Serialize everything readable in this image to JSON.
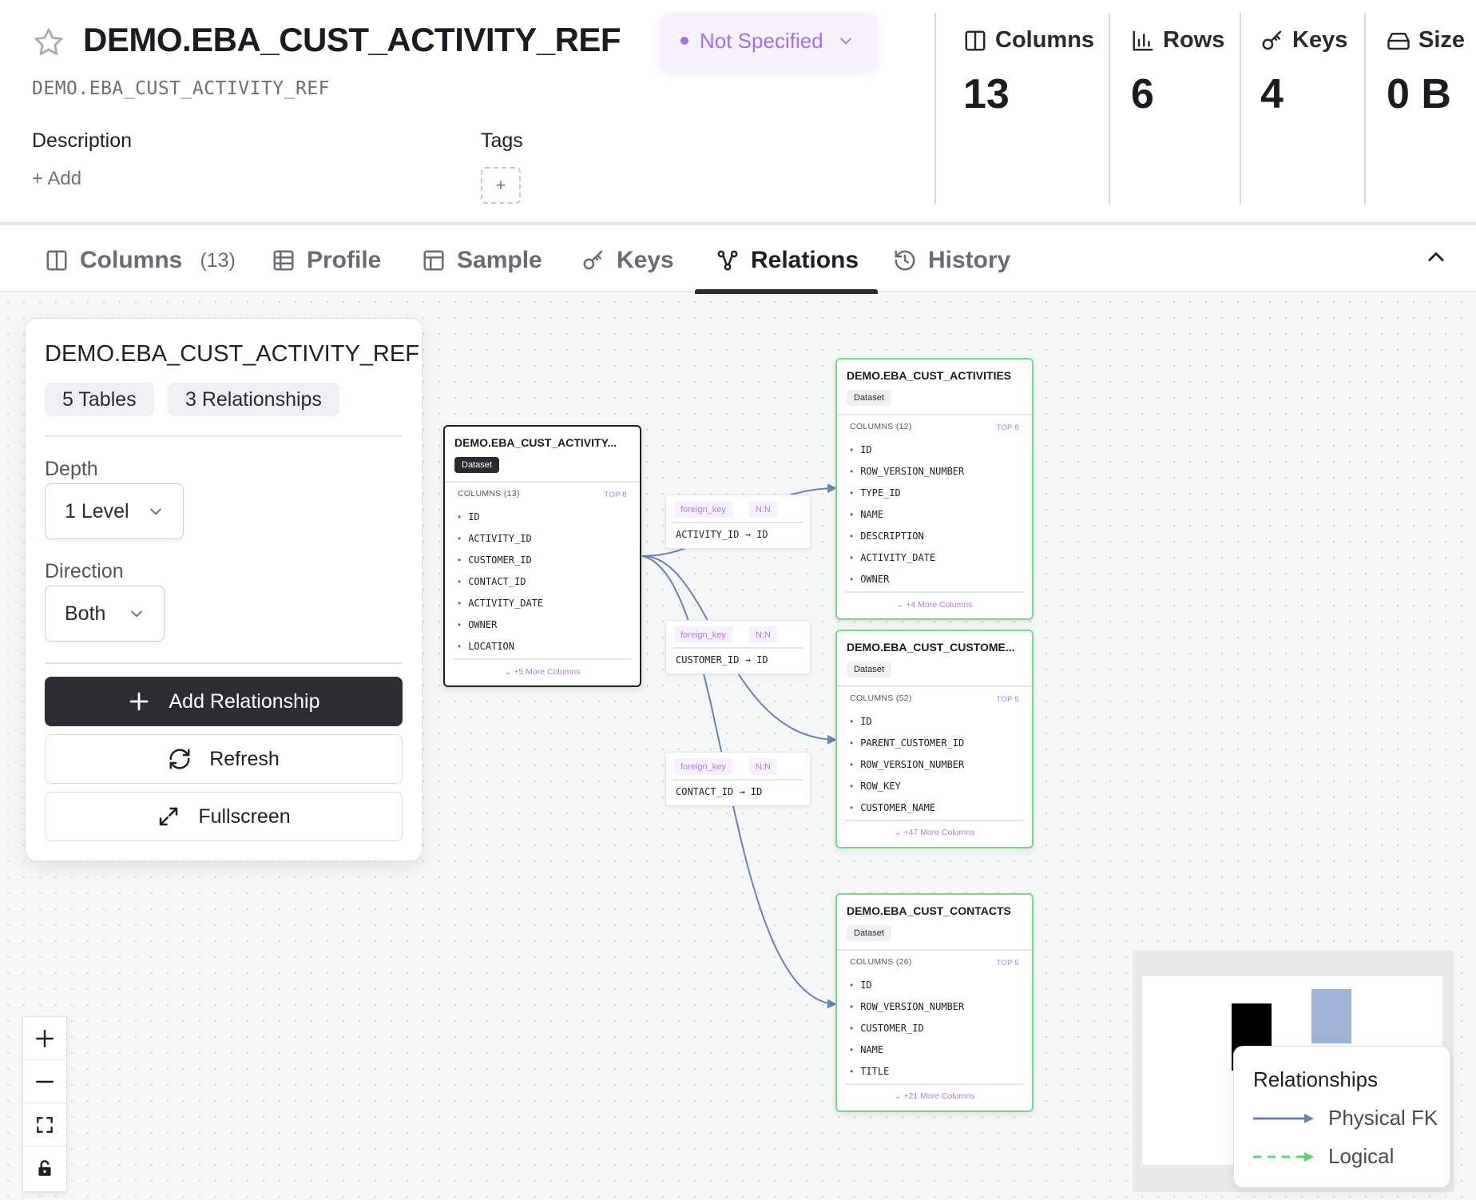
{
  "header": {
    "title": "DEMO.EBA_CUST_ACTIVITY_REF",
    "fqn": "DEMO.EBA_CUST_ACTIVITY_REF",
    "status": "Not Specified",
    "description_label": "Description",
    "description_add": "+ Add",
    "tags_label": "Tags",
    "tags_add": "+",
    "stats": [
      {
        "label": "Columns",
        "value": "13",
        "icon": "columns-icon"
      },
      {
        "label": "Rows",
        "value": "6",
        "icon": "bar-chart-icon"
      },
      {
        "label": "Keys",
        "value": "4",
        "icon": "key-icon"
      },
      {
        "label": "Size",
        "value": "0 B",
        "icon": "hard-drive-icon"
      }
    ]
  },
  "tabs": [
    {
      "label": "Columns",
      "count": "(13)",
      "icon": "columns-icon"
    },
    {
      "label": "Profile",
      "icon": "table-icon"
    },
    {
      "label": "Sample",
      "icon": "layout-icon"
    },
    {
      "label": "Keys",
      "icon": "key-icon"
    },
    {
      "label": "Relations",
      "icon": "relations-icon",
      "active": true
    },
    {
      "label": "History",
      "icon": "history-icon"
    }
  ],
  "panel": {
    "title": "DEMO.EBA_CUST_ACTIVITY_REF",
    "tables_chip": "5 Tables",
    "relationships_chip": "3 Relationships",
    "depth_label": "Depth",
    "depth_value": "1 Level",
    "direction_label": "Direction",
    "direction_value": "Both",
    "add_button": "Add Relationship",
    "refresh_button": "Refresh",
    "fullscreen_button": "Fullscreen"
  },
  "nodes": {
    "center": {
      "title": "DEMO.EBA_CUST_ACTIVITY...",
      "badge": "Dataset",
      "col_header": "COLUMNS (13)",
      "top": "TOP 8",
      "columns": [
        "ID",
        "ACTIVITY_ID",
        "CUSTOMER_ID",
        "CONTACT_ID",
        "ACTIVITY_DATE",
        "OWNER",
        "LOCATION"
      ],
      "more": "⌄ +5 More Columns"
    },
    "activities": {
      "title": "DEMO.EBA_CUST_ACTIVITIES",
      "badge": "Dataset",
      "col_header": "COLUMNS (12)",
      "top": "TOP 8",
      "columns": [
        "ID",
        "ROW_VERSION_NUMBER",
        "TYPE_ID",
        "NAME",
        "DESCRIPTION",
        "ACTIVITY_DATE",
        "OWNER"
      ],
      "more": "⌄ +4 More Columns"
    },
    "customers": {
      "title": "DEMO.EBA_CUST_CUSTOME...",
      "badge": "Dataset",
      "col_header": "COLUMNS (52)",
      "top": "TOP 5",
      "columns": [
        "ID",
        "PARENT_CUSTOMER_ID",
        "ROW_VERSION_NUMBER",
        "ROW_KEY",
        "CUSTOMER_NAME"
      ],
      "more": "⌄ +47 More Columns"
    },
    "contacts": {
      "title": "DEMO.EBA_CUST_CONTACTS",
      "badge": "Dataset",
      "col_header": "COLUMNS (26)",
      "top": "TOP 5",
      "columns": [
        "ID",
        "ROW_VERSION_NUMBER",
        "CUSTOMER_ID",
        "NAME",
        "TITLE"
      ],
      "more": "⌄ +21 More Columns"
    }
  },
  "edges": [
    {
      "type": "foreign_key",
      "cardinality": "N:N",
      "mapping": "ACTIVITY_ID → ID"
    },
    {
      "type": "foreign_key",
      "cardinality": "N:N",
      "mapping": "CUSTOMER_ID → ID"
    },
    {
      "type": "foreign_key",
      "cardinality": "N:N",
      "mapping": "CONTACT_ID → ID"
    }
  ],
  "legend": {
    "title": "Relationships",
    "physical": "Physical FK",
    "logical": "Logical"
  },
  "colors": {
    "accent": "#a271e8",
    "physical_fk": "#6b82b0",
    "logical": "#5fd36f",
    "dark_button": "#2c2d32"
  }
}
